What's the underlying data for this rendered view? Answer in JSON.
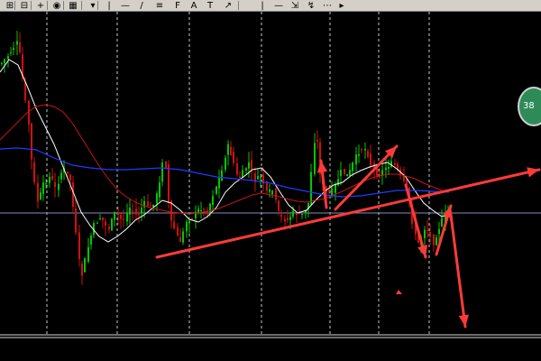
{
  "toolbar": {
    "buttons": [
      {
        "name": "zoom-in-icon",
        "glyph": "⊞"
      },
      {
        "name": "zoom-out-icon",
        "glyph": "⊟"
      },
      {
        "name": "add-indicator-icon",
        "glyph": "+"
      },
      {
        "name": "navigator-icon",
        "glyph": "◉"
      },
      {
        "name": "template-icon",
        "glyph": "▦"
      },
      {
        "name": "cursor-icon",
        "glyph": "▾"
      },
      {
        "name": "vertical-line-icon",
        "glyph": "|"
      },
      {
        "name": "horizontal-line-icon",
        "glyph": "—"
      },
      {
        "name": "trendline-icon",
        "glyph": "/"
      },
      {
        "name": "channel-icon",
        "glyph": "≡"
      },
      {
        "name": "fib-icon",
        "glyph": "F"
      },
      {
        "name": "text-icon",
        "glyph": "A"
      },
      {
        "name": "label-icon",
        "glyph": "T"
      },
      {
        "name": "arrow-tool-icon",
        "glyph": "↗"
      },
      {
        "name": "period-line-icon",
        "glyph": "|"
      },
      {
        "name": "step-icon",
        "glyph": "—"
      },
      {
        "name": "shift-icon",
        "glyph": "⇲"
      },
      {
        "name": "fan-icon",
        "glyph": "↯"
      },
      {
        "name": "grid-icon",
        "glyph": "⋯"
      },
      {
        "name": "more-icon",
        "glyph": "▸"
      }
    ]
  },
  "badge_text": "38",
  "colors": {
    "background": "#000000",
    "bull": "#00c800",
    "bear": "#d01010",
    "ma_fast": "#ffffff",
    "ma_mid": "#c81414",
    "ma_slow": "#1e3cff",
    "arrows": "#ff3a3a",
    "grid": "#c8c8c8",
    "price_line": "#7f8fbf"
  },
  "chart_data": {
    "type": "candlestick",
    "title": "",
    "grid": "vertical dashed",
    "moving_averages": [
      "white fast",
      "red medium",
      "blue slow"
    ],
    "annotations": [
      "red trend line rising",
      "red arrows down",
      "red arrow up"
    ]
  }
}
